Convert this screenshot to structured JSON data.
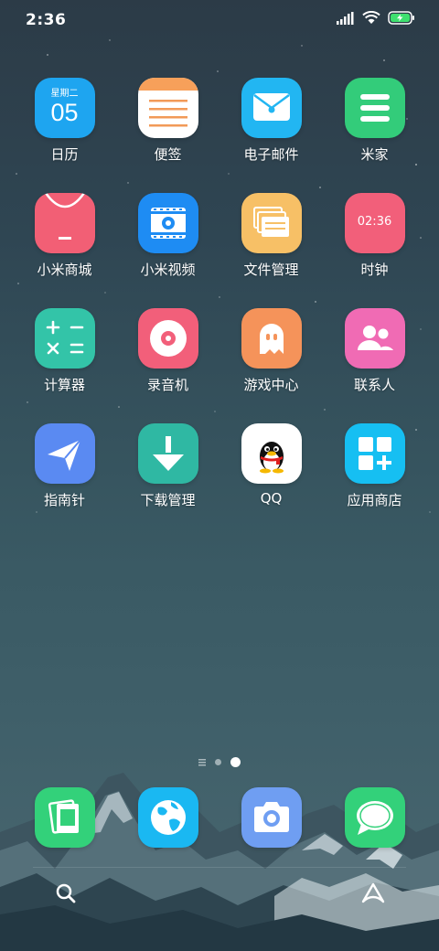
{
  "status": {
    "time": "2:36"
  },
  "apps": [
    {
      "label": "日历",
      "icon": "calendar-icon",
      "weekday": "星期二",
      "day": "05",
      "color": "#1ea5f0"
    },
    {
      "label": "便签",
      "icon": "notes-icon",
      "color": "#ffffff"
    },
    {
      "label": "电子邮件",
      "icon": "mail-icon",
      "color": "#22b6f2"
    },
    {
      "label": "米家",
      "icon": "mijia-icon",
      "color": "#33cc7a"
    },
    {
      "label": "小米商城",
      "icon": "shopping-bag-icon",
      "color": "#f25f75"
    },
    {
      "label": "小米视频",
      "icon": "video-icon",
      "color": "#1e8cf3"
    },
    {
      "label": "文件管理",
      "icon": "folder-icon",
      "color": "#f7c066"
    },
    {
      "label": "时钟",
      "icon": "clock-icon",
      "clock_time": "02:36",
      "color": "#f25f7a"
    },
    {
      "label": "计算器",
      "icon": "calculator-icon",
      "color": "#33c4a8"
    },
    {
      "label": "录音机",
      "icon": "recorder-icon",
      "color": "#f25f7a"
    },
    {
      "label": "游戏中心",
      "icon": "game-ghost-icon",
      "color": "#f5935a"
    },
    {
      "label": "联系人",
      "icon": "contacts-icon",
      "color": "#f06bb4"
    },
    {
      "label": "指南针",
      "icon": "compass-icon",
      "color": "#5a8af2"
    },
    {
      "label": "下载管理",
      "icon": "download-icon",
      "color": "#2fb8a3"
    },
    {
      "label": "QQ",
      "icon": "qq-penguin-icon",
      "color": "#ffffff"
    },
    {
      "label": "应用商店",
      "icon": "app-store-icon",
      "color": "#16bff2"
    }
  ],
  "dock": [
    {
      "icon": "gallery-icon",
      "color": "#33d17a"
    },
    {
      "icon": "browser-globe-icon",
      "color": "#1ab8f2"
    },
    {
      "icon": "camera-icon",
      "color": "#6f9ef2"
    },
    {
      "icon": "messages-icon",
      "color": "#33d17a"
    }
  ],
  "page_indicator": {
    "pages": 2,
    "current": 2
  }
}
